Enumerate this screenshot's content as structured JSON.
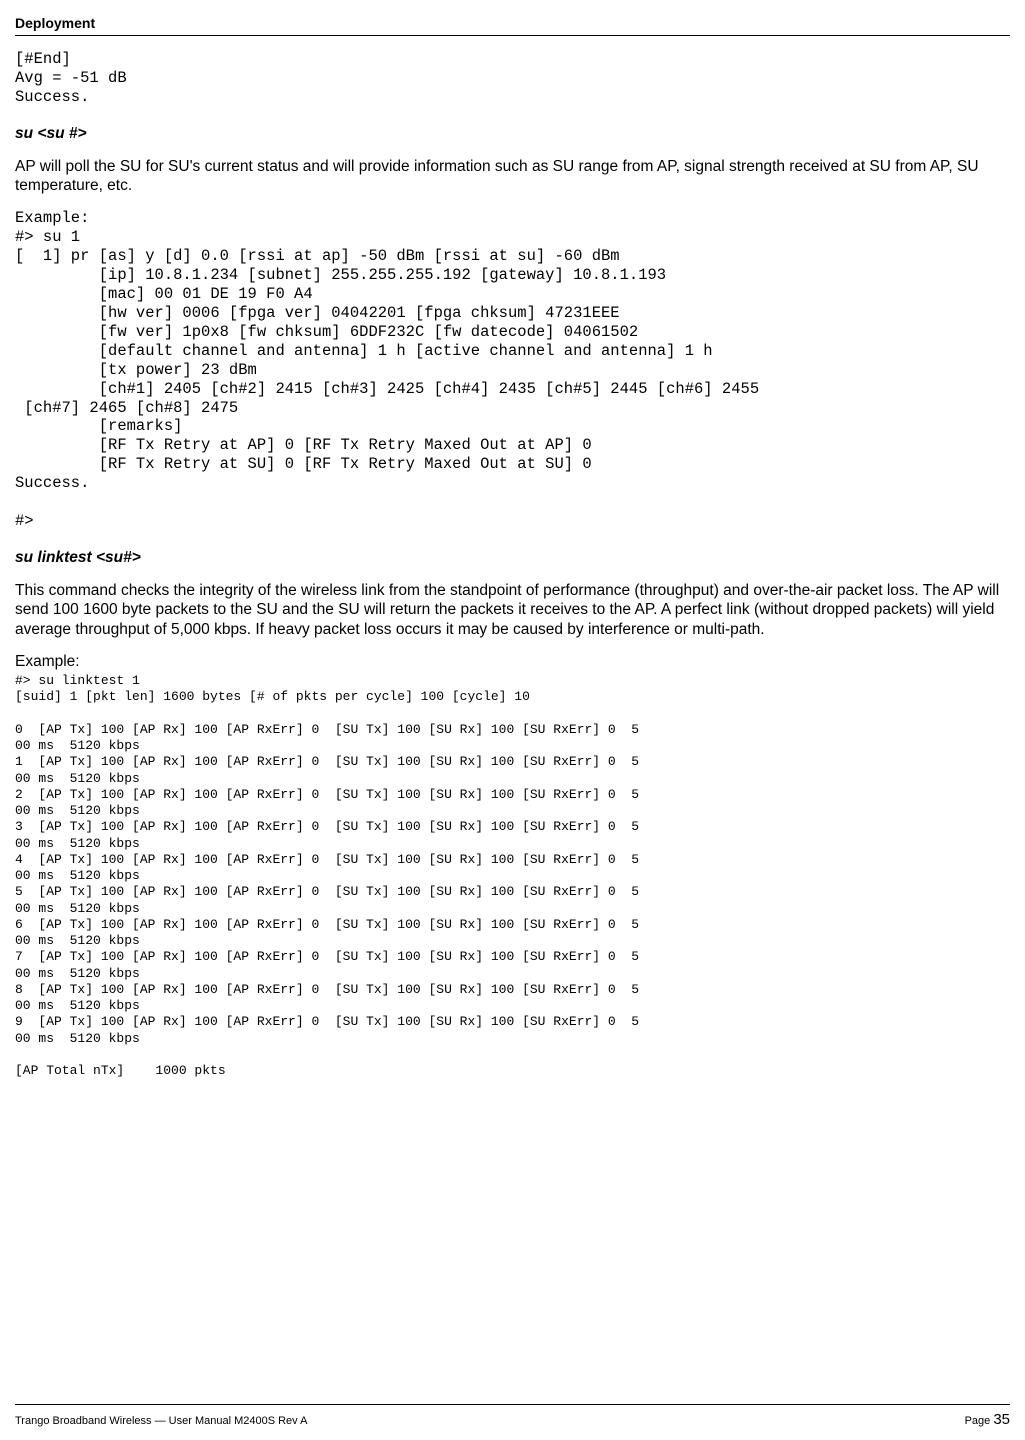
{
  "header": {
    "title": "Deployment"
  },
  "blocks": {
    "intro_code": "[#End]\nAvg = -51 dB\nSuccess.",
    "su_heading": "su  <su #>",
    "su_desc": "AP will poll the SU for SU's current status and will provide information such as SU range from AP, signal strength received at SU from AP, SU temperature, etc.",
    "su_example": "Example:\n#> su 1\n[  1] pr [as] y [d] 0.0 [rssi at ap] -50 dBm [rssi at su] -60 dBm\n         [ip] 10.8.1.234 [subnet] 255.255.255.192 [gateway] 10.8.1.193\n         [mac] 00 01 DE 19 F0 A4\n         [hw ver] 0006 [fpga ver] 04042201 [fpga chksum] 47231EEE\n         [fw ver] 1p0x8 [fw chksum] 6DDF232C [fw datecode] 04061502\n         [default channel and antenna] 1 h [active channel and antenna] 1 h\n         [tx power] 23 dBm\n         [ch#1] 2405 [ch#2] 2415 [ch#3] 2425 [ch#4] 2435 [ch#5] 2445 [ch#6] 2455\n [ch#7] 2465 [ch#8] 2475\n         [remarks]\n         [RF Tx Retry at AP] 0 [RF Tx Retry Maxed Out at AP] 0\n         [RF Tx Retry at SU] 0 [RF Tx Retry Maxed Out at SU] 0\nSuccess.\n\n#>",
    "linktest_heading": "su linktest  <su#>",
    "linktest_desc": "This command checks the integrity of the wireless link from the standpoint of performance (throughput) and over-the-air packet loss.  The AP will send 100 1600 byte packets to the SU and the SU will return the packets it receives to the AP. A perfect link (without dropped packets) will yield average throughput of 5,000 kbps.  If heavy packet loss occurs it may be caused by interference or multi-path.",
    "example_label": "Example:",
    "linktest_output": "#> su linktest 1\n[suid] 1 [pkt len] 1600 bytes [# of pkts per cycle] 100 [cycle] 10\n\n0  [AP Tx] 100 [AP Rx] 100 [AP RxErr] 0  [SU Tx] 100 [SU Rx] 100 [SU RxErr] 0  5\n00 ms  5120 kbps\n1  [AP Tx] 100 [AP Rx] 100 [AP RxErr] 0  [SU Tx] 100 [SU Rx] 100 [SU RxErr] 0  5\n00 ms  5120 kbps\n2  [AP Tx] 100 [AP Rx] 100 [AP RxErr] 0  [SU Tx] 100 [SU Rx] 100 [SU RxErr] 0  5\n00 ms  5120 kbps\n3  [AP Tx] 100 [AP Rx] 100 [AP RxErr] 0  [SU Tx] 100 [SU Rx] 100 [SU RxErr] 0  5\n00 ms  5120 kbps\n4  [AP Tx] 100 [AP Rx] 100 [AP RxErr] 0  [SU Tx] 100 [SU Rx] 100 [SU RxErr] 0  5\n00 ms  5120 kbps\n5  [AP Tx] 100 [AP Rx] 100 [AP RxErr] 0  [SU Tx] 100 [SU Rx] 100 [SU RxErr] 0  5\n00 ms  5120 kbps\n6  [AP Tx] 100 [AP Rx] 100 [AP RxErr] 0  [SU Tx] 100 [SU Rx] 100 [SU RxErr] 0  5\n00 ms  5120 kbps\n7  [AP Tx] 100 [AP Rx] 100 [AP RxErr] 0  [SU Tx] 100 [SU Rx] 100 [SU RxErr] 0  5\n00 ms  5120 kbps\n8  [AP Tx] 100 [AP Rx] 100 [AP RxErr] 0  [SU Tx] 100 [SU Rx] 100 [SU RxErr] 0  5\n00 ms  5120 kbps\n9  [AP Tx] 100 [AP Rx] 100 [AP RxErr] 0  [SU Tx] 100 [SU Rx] 100 [SU RxErr] 0  5\n00 ms  5120 kbps\n\n[AP Total nTx]    1000 pkts"
  },
  "footer": {
    "left": "Trango Broadband Wireless — User Manual M2400S Rev A",
    "page_label": "Page ",
    "page_num": "35"
  }
}
